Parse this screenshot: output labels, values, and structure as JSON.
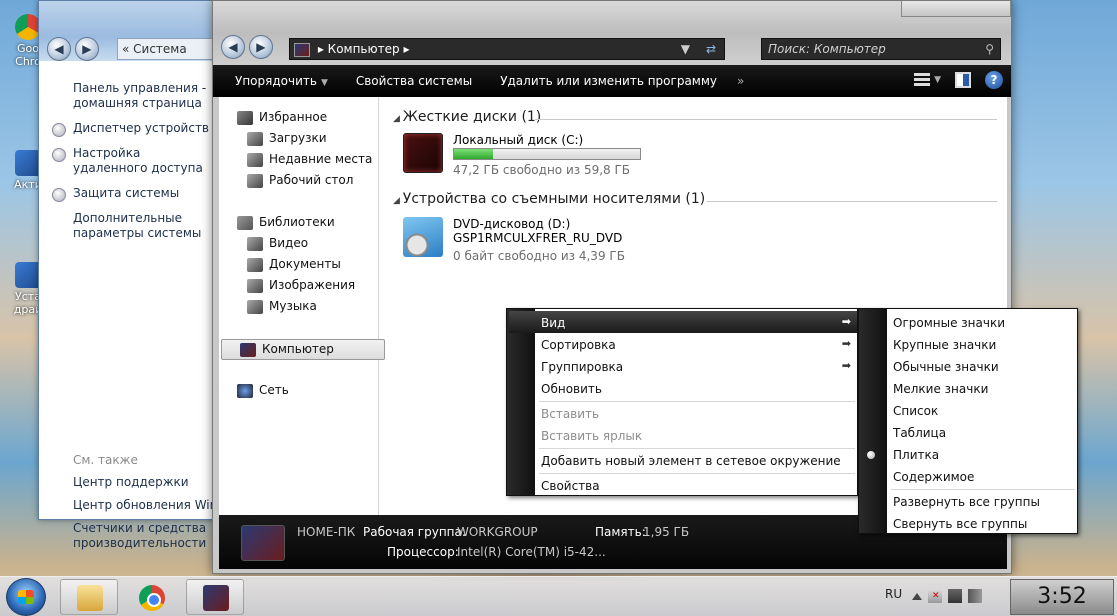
{
  "desktop": {
    "icons": [
      {
        "label": "Goo Chro"
      },
      {
        "label": "Акти"
      },
      {
        "label": "Уста драй"
      }
    ]
  },
  "control_panel": {
    "breadcrumb": "Система",
    "links_top": [
      "Панель управления - домашняя страница",
      "Диспетчер устройств",
      "Настройка удаленного доступа",
      "Защита системы",
      "Дополнительные параметры системы"
    ],
    "see_also_title": "См. также",
    "links_bottom": [
      "Центр поддержки",
      "Центр обновления Windows",
      "Счетчики и средства производительности"
    ]
  },
  "explorer": {
    "address": "Компьютер",
    "search_placeholder": "Поиск: Компьютер",
    "toolbar": {
      "organize": "Упорядочить",
      "system_properties": "Свойства системы",
      "uninstall": "Удалить или изменить программу",
      "more": "»"
    },
    "nav": {
      "favorites": "Избранное",
      "downloads": "Загрузки",
      "recent": "Недавние места",
      "desktop": "Рабочий стол",
      "libraries": "Библиотеки",
      "video": "Видео",
      "documents": "Документы",
      "images": "Изображения",
      "music": "Музыка",
      "computer": "Компьютер",
      "network": "Сеть"
    },
    "sections": {
      "hard_disks": "Жесткие диски (1)",
      "removable": "Устройства со съемными носителями (1)"
    },
    "drive_c": {
      "name": "Локальный диск (C:)",
      "free": "47,2 ГБ свободно из 59,8 ГБ",
      "used_fraction": 0.21
    },
    "drive_d": {
      "name": "DVD-дисковод (D:)",
      "label": "GSP1RMCULXFRER_RU_DVD",
      "free": "0 байт свободно из 4,39 ГБ"
    },
    "details": {
      "pc_name": "HOME-ПК",
      "workgroup_label": "Рабочая группа:",
      "workgroup_value": "WORKGROUP",
      "memory_label": "Память:",
      "memory_value": "1,95 ГБ",
      "cpu_label": "Процессор:",
      "cpu_value": "Intel(R) Core(TM) i5-42..."
    }
  },
  "context_menu": {
    "items": {
      "view": "Вид",
      "sort": "Сортировка",
      "group": "Группировка",
      "refresh": "Обновить",
      "paste": "Вставить",
      "paste_shortcut": "Вставить ярлык",
      "add_network": "Добавить новый элемент в сетевое окружение",
      "properties": "Свойства"
    },
    "arrow": "➡"
  },
  "view_submenu": {
    "items": {
      "huge": "Огромные значки",
      "large": "Крупные значки",
      "normal": "Обычные значки",
      "small": "Мелкие значки",
      "list": "Список",
      "table": "Таблица",
      "tile": "Плитка",
      "content": "Содержимое",
      "expand": "Развернуть все группы",
      "collapse": "Свернуть все группы"
    },
    "selected": "tile"
  },
  "taskbar": {
    "language": "RU",
    "clock": "3:52"
  }
}
